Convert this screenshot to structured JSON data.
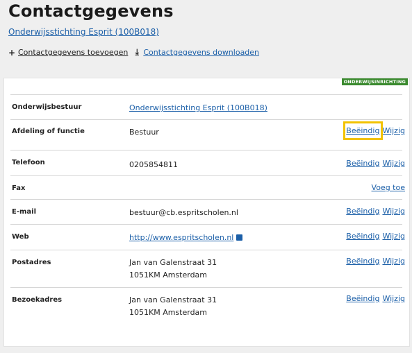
{
  "header": {
    "title": "Contactgegevens",
    "org_link": "Onderwijsstichting Esprit (100B018)"
  },
  "actions": [
    {
      "icon": "plus-icon",
      "label": "Contactgegevens toevoegen"
    },
    {
      "icon": "download-icon",
      "label": "Contactgegevens downloaden"
    }
  ],
  "panel": {
    "badge": "ONDERWIJSINRICHTING",
    "rows": [
      {
        "label": "Onderwijsbestuur",
        "value": "Onderwijsstichting Esprit (100B018)",
        "value2": ""
      },
      {
        "label": "Afdeling of functie",
        "value": "Bestuur",
        "end": "Beëindig",
        "edit": "Wijzig"
      },
      {
        "label": "Telefoon",
        "value": "0205854811",
        "end": "Beëindig",
        "edit": "Wijzig"
      },
      {
        "label": "Fax",
        "value": "",
        "add": "Voeg toe"
      },
      {
        "label": "E-mail",
        "value": "bestuur@cb.espritscholen.nl",
        "end": "Beëindig",
        "edit": "Wijzig"
      },
      {
        "label": "Web",
        "value": "http://www.espritscholen.nl",
        "end": "Beëindig",
        "edit": "Wijzig"
      },
      {
        "label": "Postadres",
        "value": "Jan van Galenstraat 31",
        "value2": "1051KM Amsterdam",
        "end": "Beëindig",
        "edit": "Wijzig"
      },
      {
        "label": "Bezoekadres",
        "value": "Jan van Galenstraat 31",
        "value2": "1051KM Amsterdam",
        "end": "Beëindig",
        "edit": "Wijzig"
      }
    ]
  },
  "colors": {
    "link": "#1b5fa8",
    "badge": "#3a8a2e",
    "highlight": "#f2c200"
  }
}
